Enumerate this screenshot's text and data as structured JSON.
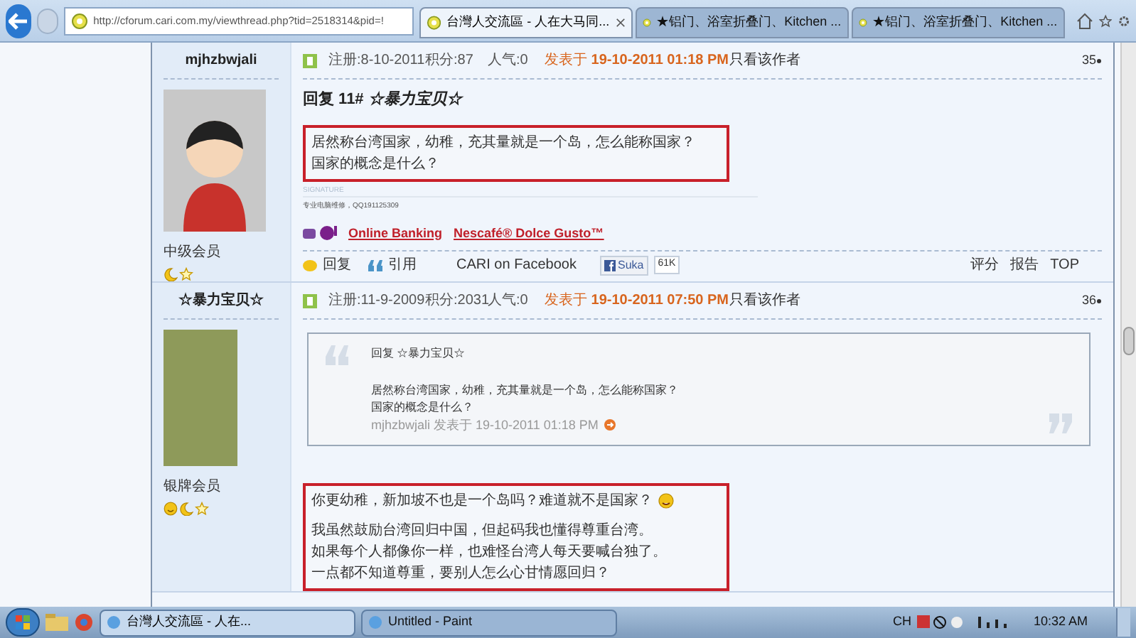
{
  "browser": {
    "address": "http://cforum.cari.com.my/viewthread.php?tid=2518314&pid=!",
    "tabs": [
      {
        "label": "台灣人交流區 - 人在大马同...",
        "selected": true
      },
      {
        "label": "★铝门、浴室折叠门、Kitchen ...",
        "selected": false
      },
      {
        "label": "★铝门、浴室折叠门、Kitchen ...",
        "selected": false
      }
    ]
  },
  "posts": [
    {
      "author": "mjhzbwjali",
      "rank": "中级会员",
      "join": "注册:8-10-2011",
      "points": "积分:87",
      "popularity": "人气:0",
      "posted_label": "发表于",
      "posted_time": "19-10-2011 01:18 PM",
      "author_only": "只看该作者",
      "floor": "35",
      "title": "回复 11# *☆暴力宝贝☆*",
      "body": [
        "居然称台湾国家，幼稚，充其量就是一个岛，怎么能称国家？",
        "国家的概念是什么？"
      ],
      "signature_label": "SIGNATURE",
      "signature": "专业电脑维修，QQ191125309",
      "ads": [
        "Online Banking",
        "Nescafé® Dolce Gusto™"
      ],
      "actions": {
        "reply": "回复",
        "quote": "引用",
        "facebook": "CARI on Facebook",
        "like": "Suka",
        "like_count": "61K",
        "rate": "评分",
        "report": "报告",
        "top": "TOP"
      }
    },
    {
      "author": "☆暴力宝贝☆",
      "rank": "银牌会员",
      "join": "注册:11-9-2009",
      "points": "积分:2031",
      "popularity": "人气:0",
      "posted_label": "发表于",
      "posted_time": "19-10-2011 07:50 PM",
      "author_only": "只看该作者",
      "floor": "36",
      "quote": {
        "heading": "回复  ☆暴力宝贝☆",
        "lines": [
          "居然称台湾国家，幼稚，充其量就是一个岛，怎么能称国家？",
          "国家的概念是什么？"
        ],
        "source": "mjhzbwjali 发表于 19-10-2011 01:18 PM"
      },
      "paragraphs": [
        [
          "你更幼稚，新加坡不也是一个岛吗？难道就不是国家？"
        ],
        [
          "我虽然鼓励台湾回归中国，但起码我也懂得尊重台湾。",
          "如果每个人都像你一样，也难怪台湾人每天要喊台独了。",
          "一点都不知道尊重，要别人怎么心甘情愿回归？"
        ]
      ]
    }
  ],
  "taskbar": {
    "items": [
      {
        "label": "台灣人交流區 - 人在...",
        "selected": true
      },
      {
        "label": "Untitled - Paint",
        "selected": false
      }
    ],
    "language": "CH",
    "clock": "10:32 AM"
  }
}
